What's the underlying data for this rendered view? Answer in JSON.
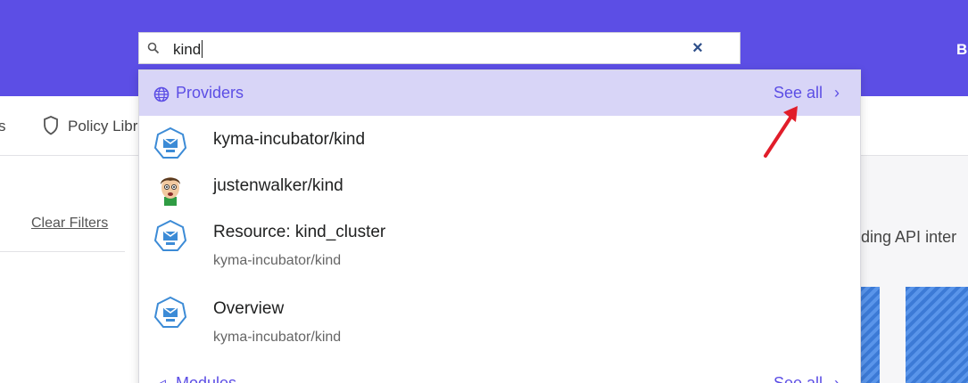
{
  "header": {
    "right_letter": "B"
  },
  "search": {
    "query": "kind",
    "clear_icon": "close-icon",
    "search_icon": "search-icon"
  },
  "subnav": {
    "fragment": "s",
    "policy_label": "Policy Libr"
  },
  "filters": {
    "clear_label": "Clear Filters"
  },
  "background": {
    "right_text": "nding API inter"
  },
  "dropdown": {
    "providers": {
      "title": "Providers",
      "see_all": "See all",
      "items": [
        {
          "name": "kyma-incubator/kind",
          "icon": "kubernetes-icon"
        },
        {
          "name": "justenwalker/kind",
          "icon": "avatar"
        },
        {
          "name": "Resource: kind_cluster",
          "sub": "kyma-incubator/kind",
          "icon": "kubernetes-icon"
        },
        {
          "name": "Overview",
          "sub": "kyma-incubator/kind",
          "icon": "kubernetes-icon"
        }
      ]
    },
    "modules": {
      "title": "Modules",
      "see_all": "See all"
    }
  },
  "colors": {
    "brand": "#5c4ee5",
    "section_bg": "#d8d5f7",
    "arrow": "#e11d2a",
    "k8s": "#3c8bd6"
  }
}
